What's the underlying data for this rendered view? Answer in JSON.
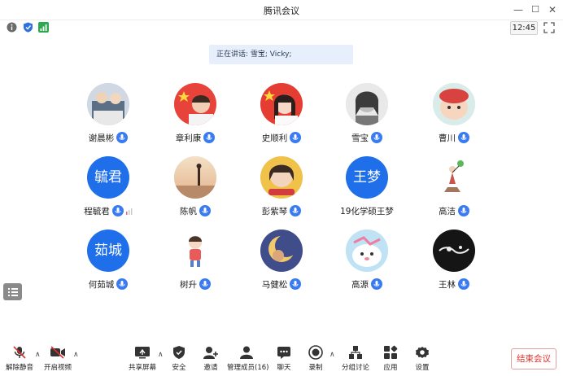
{
  "window": {
    "title": "腾讯会议",
    "minimize": "—",
    "maximize": "☐",
    "close": "✕"
  },
  "status": {
    "time": "12:45"
  },
  "speaking_text": "正在讲话: 雪宝; Vicky;",
  "participants": [
    {
      "name": "谢晨彬",
      "avatar_text": ""
    },
    {
      "name": "章利康",
      "avatar_text": ""
    },
    {
      "name": "史顺利",
      "avatar_text": ""
    },
    {
      "name": "雪宝",
      "avatar_text": ""
    },
    {
      "name": "曹川",
      "avatar_text": ""
    },
    {
      "name": "程毓君",
      "avatar_text": "毓君"
    },
    {
      "name": "陈帆",
      "avatar_text": ""
    },
    {
      "name": "彭紫琴",
      "avatar_text": ""
    },
    {
      "name": "19化学硕王梦",
      "avatar_text": "王梦"
    },
    {
      "name": "高洁",
      "avatar_text": ""
    },
    {
      "name": "何茹城",
      "avatar_text": "茹城"
    },
    {
      "name": "树升",
      "avatar_text": ""
    },
    {
      "name": "马健松",
      "avatar_text": ""
    },
    {
      "name": "高源",
      "avatar_text": ""
    },
    {
      "name": "王林",
      "avatar_text": ""
    }
  ],
  "toolbar": {
    "unmute": "解除静音",
    "start_video": "开启视频",
    "share_screen": "共享屏幕",
    "security": "安全",
    "invite": "邀请",
    "manage_members": "管理成员(16)",
    "chat": "聊天",
    "record": "录制",
    "breakout": "分组讨论",
    "apps": "应用",
    "settings": "设置",
    "end_meeting": "结束会议"
  },
  "colors": {
    "accent": "#1f6feb",
    "mic_blue": "#3a7bf2",
    "end_red": "#e0302a"
  }
}
